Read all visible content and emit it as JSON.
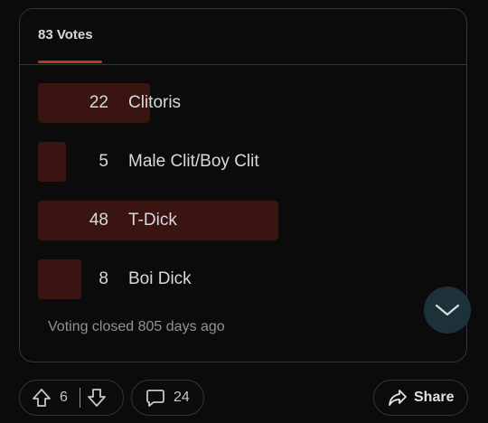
{
  "poll": {
    "tab_label": "83 Votes",
    "options": [
      {
        "count": "22",
        "label": "Clitoris",
        "fraction": 0.265
      },
      {
        "count": "5",
        "label": "Male Clit/Boy Clit",
        "fraction": 0.06
      },
      {
        "count": "48",
        "label": "T-Dick",
        "fraction": 0.578
      },
      {
        "count": "8",
        "label": "Boi Dick",
        "fraction": 0.096
      }
    ],
    "status": "Voting closed 805 days ago"
  },
  "actions": {
    "upvotes": "6",
    "comments": "24",
    "share_label": "Share"
  },
  "colors": {
    "accent": "#b93a24",
    "bar": "#3a1410",
    "scroll_button": "#1d3238"
  },
  "icons": [
    "chevron-down-icon",
    "upvote-icon",
    "downvote-icon",
    "comment-icon",
    "share-icon"
  ]
}
